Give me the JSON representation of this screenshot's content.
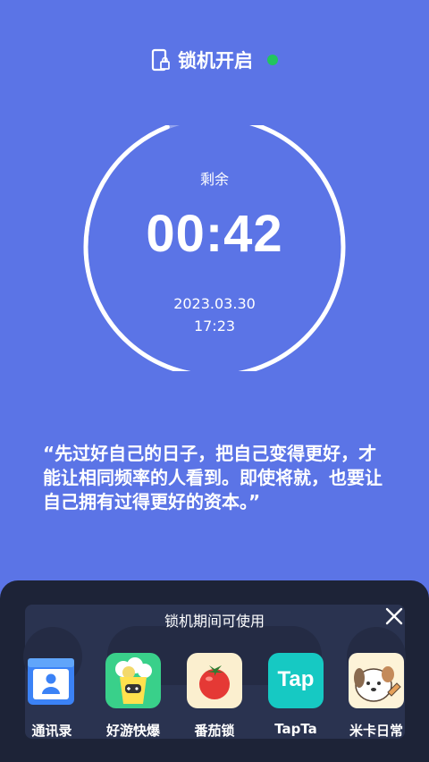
{
  "status": {
    "label": "锁机开启",
    "indicator_color": "#22c55e"
  },
  "timer": {
    "remaining_label": "剩余",
    "time": "00:42",
    "date": "2023.03.30",
    "clock": "17:23",
    "progress": 0.94
  },
  "quote": "“先过好自己的日子，把自己变得更好，才能让相同频率的人看到。即使将就，也要让自己拥有过得更好的资本。”",
  "panel": {
    "title": "锁机期间可使用",
    "close_icon": "close-icon",
    "apps": [
      {
        "label": "通讯录",
        "icon": "contacts-icon"
      },
      {
        "label": "好游快爆",
        "icon": "haoyou-kuaibao-icon"
      },
      {
        "label": "番茄锁",
        "icon": "tomato-icon"
      },
      {
        "label": "TapTa",
        "icon": "taptap-icon",
        "icon_text": "Tap"
      },
      {
        "label": "米卡日常",
        "icon": "dog-cartoon-icon"
      }
    ]
  }
}
